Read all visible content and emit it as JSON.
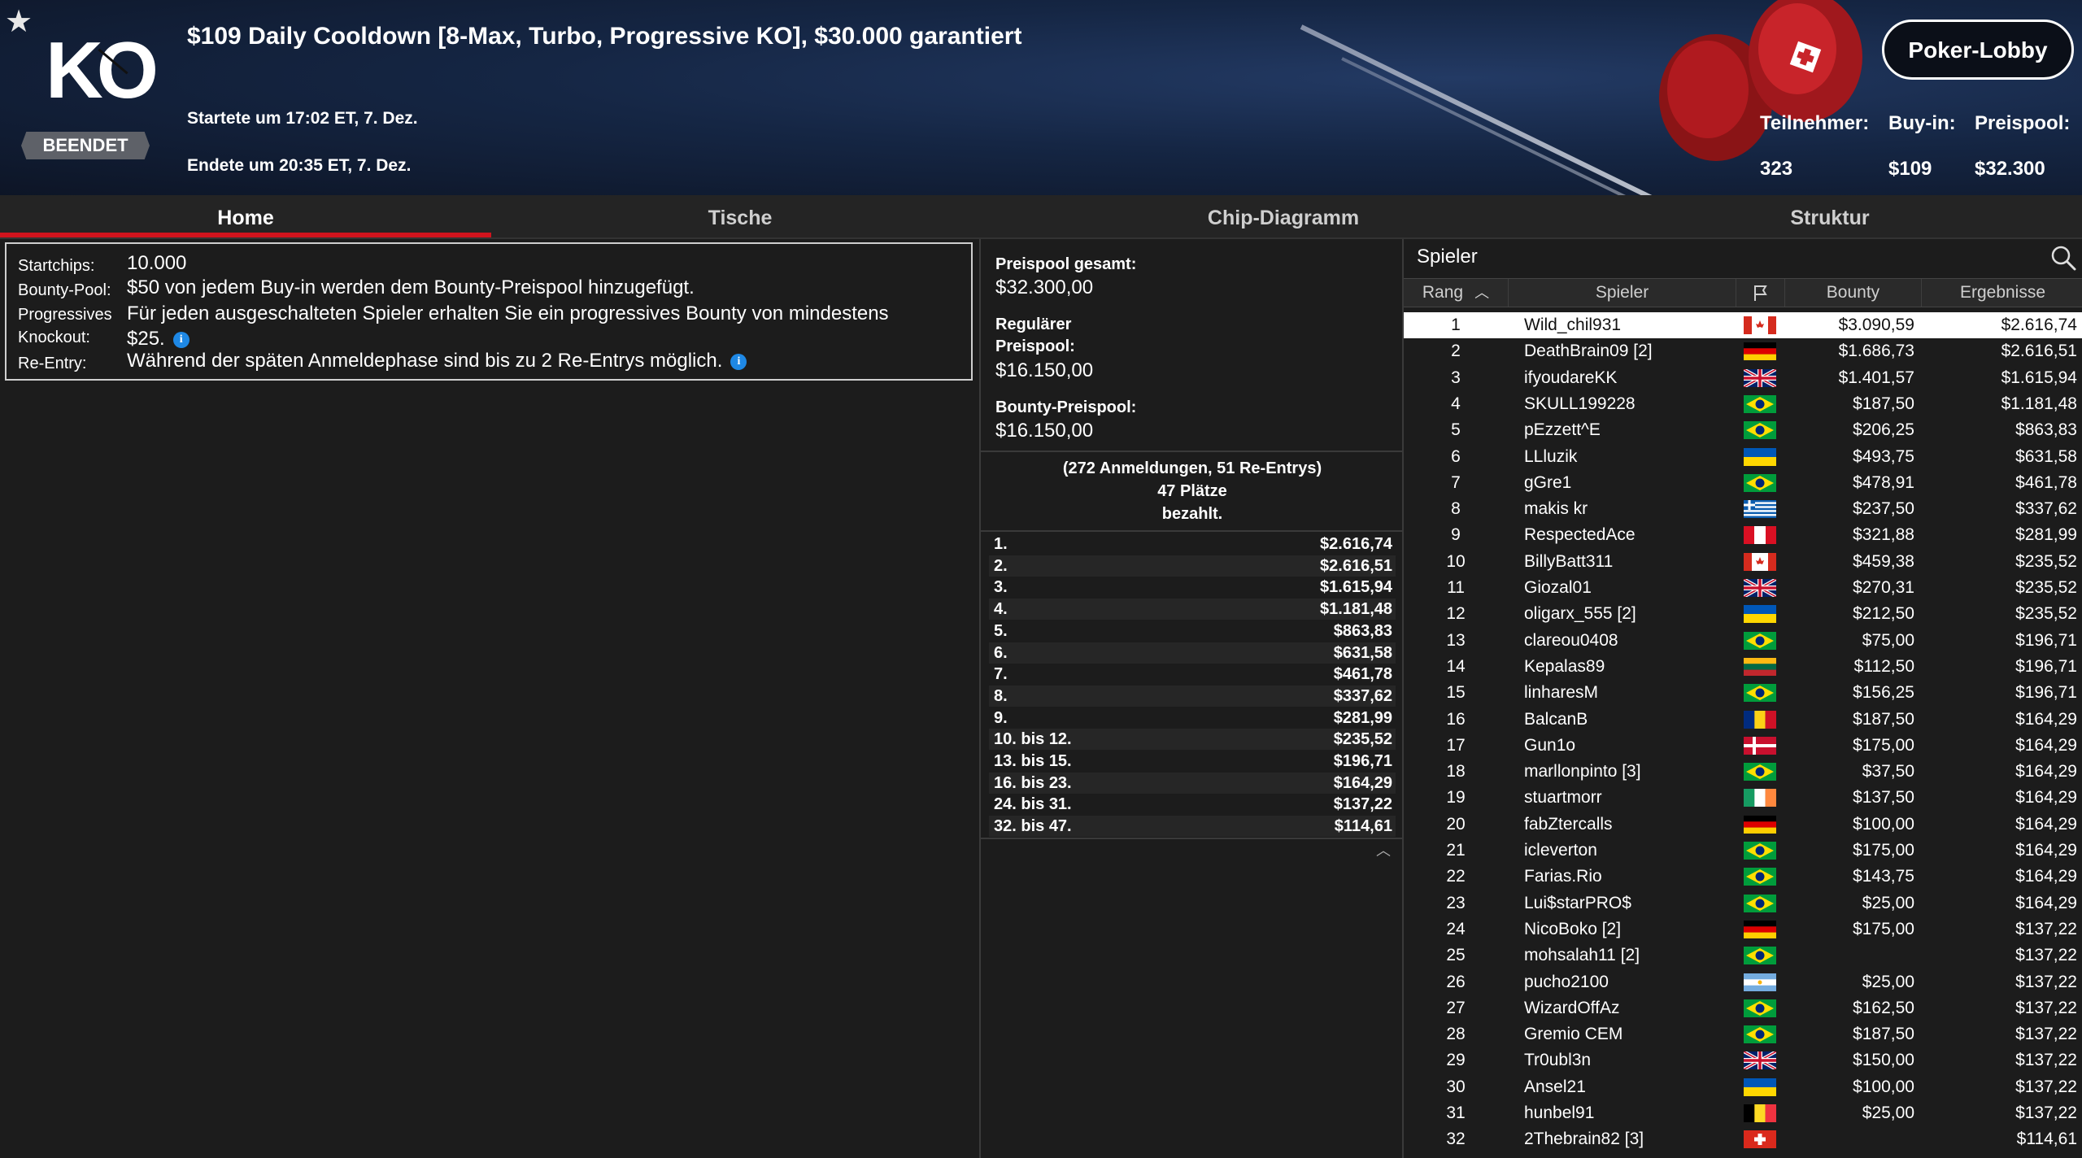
{
  "header": {
    "title": "$109 Daily Cooldown [8-Max, Turbo, Progressive KO], $30.000 garantiert",
    "logo_text": "KO",
    "status": "BEENDET",
    "started": "Startete um 17:02 ET, 7. Dez.",
    "ended": "Endete um 20:35 ET, 7. Dez.",
    "lobby_button": "Poker-Lobby",
    "stats": {
      "participants_label": "Teilnehmer:",
      "participants_value": "323",
      "buyin_label": "Buy-in:",
      "buyin_value": "$109",
      "prizepool_label": "Preispool:",
      "prizepool_value": "$32.300"
    }
  },
  "tabs": [
    "Home",
    "Tische",
    "Chip-Diagramm",
    "Struktur"
  ],
  "info": {
    "startchips_label": "Startchips:",
    "startchips_value": "10.000",
    "bounty_pool_label": "Bounty-Pool:",
    "bounty_pool_value": "$50 von jedem Buy-in werden dem Bounty-Preispool hinzugefügt.",
    "progressive_label_1": "Progressives",
    "progressive_label_2": "Knockout:",
    "progressive_value_1": "Für jeden ausgeschalteten Spieler erhalten Sie ein progressives Bounty von mindestens",
    "progressive_value_2": "$25.",
    "reentry_label": "Re-Entry:",
    "reentry_value": "Während der späten Anmeldephase sind bis zu 2 Re-Entrys möglich.",
    "info_glyph": "i"
  },
  "prizepool": {
    "total_label": "Preispool gesamt:",
    "total_value": "$32.300,00",
    "regular_label_1": "Regulärer",
    "regular_label_2": "Preispool:",
    "regular_value": "$16.150,00",
    "bounty_label": "Bounty-Preispool:",
    "bounty_value": "$16.150,00",
    "entries_line1": "(272 Anmeldungen, 51 Re-Entrys)",
    "entries_line2": "47 Plätze",
    "entries_line3": "bezahlt.",
    "payouts": [
      {
        "place": "1.",
        "amount": "$2.616,74"
      },
      {
        "place": "2.",
        "amount": "$2.616,51"
      },
      {
        "place": "3.",
        "amount": "$1.615,94"
      },
      {
        "place": "4.",
        "amount": "$1.181,48"
      },
      {
        "place": "5.",
        "amount": "$863,83"
      },
      {
        "place": "6.",
        "amount": "$631,58"
      },
      {
        "place": "7.",
        "amount": "$461,78"
      },
      {
        "place": "8.",
        "amount": "$337,62"
      },
      {
        "place": "9.",
        "amount": "$281,99"
      },
      {
        "place": "10. bis 12.",
        "amount": "$235,52"
      },
      {
        "place": "13. bis 15.",
        "amount": "$196,71"
      },
      {
        "place": "16. bis 23.",
        "amount": "$164,29"
      },
      {
        "place": "24. bis 31.",
        "amount": "$137,22"
      },
      {
        "place": "32. bis 47.",
        "amount": "$114,61"
      }
    ]
  },
  "players": {
    "title": "Spieler",
    "columns": {
      "rank": "Rang",
      "player": "Spieler",
      "bounty": "Bounty",
      "result": "Ergebnisse"
    },
    "rows": [
      {
        "rank": "1",
        "name": "Wild_chil931",
        "flag": "CA",
        "bounty": "$3.090,59",
        "result": "$2.616,74"
      },
      {
        "rank": "2",
        "name": "DeathBrain09 [2]",
        "flag": "DE",
        "bounty": "$1.686,73",
        "result": "$2.616,51"
      },
      {
        "rank": "3",
        "name": "ifyoudareKK",
        "flag": "GB",
        "bounty": "$1.401,57",
        "result": "$1.615,94"
      },
      {
        "rank": "4",
        "name": "SKULL199228",
        "flag": "BR",
        "bounty": "$187,50",
        "result": "$1.181,48"
      },
      {
        "rank": "5",
        "name": "pEzzett^E",
        "flag": "BR",
        "bounty": "$206,25",
        "result": "$863,83"
      },
      {
        "rank": "6",
        "name": "LLluzik",
        "flag": "UA",
        "bounty": "$493,75",
        "result": "$631,58"
      },
      {
        "rank": "7",
        "name": "gGre1",
        "flag": "BR",
        "bounty": "$478,91",
        "result": "$461,78"
      },
      {
        "rank": "8",
        "name": "makis kr",
        "flag": "GR",
        "bounty": "$237,50",
        "result": "$337,62"
      },
      {
        "rank": "9",
        "name": "RespectedAce",
        "flag": "PE",
        "bounty": "$321,88",
        "result": "$281,99"
      },
      {
        "rank": "10",
        "name": "BillyBatt311",
        "flag": "CA",
        "bounty": "$459,38",
        "result": "$235,52"
      },
      {
        "rank": "11",
        "name": "Giozal01",
        "flag": "GB",
        "bounty": "$270,31",
        "result": "$235,52"
      },
      {
        "rank": "12",
        "name": "oligarx_555 [2]",
        "flag": "UA",
        "bounty": "$212,50",
        "result": "$235,52"
      },
      {
        "rank": "13",
        "name": "clareou0408",
        "flag": "BR",
        "bounty": "$75,00",
        "result": "$196,71"
      },
      {
        "rank": "14",
        "name": "Kepalas89",
        "flag": "LT",
        "bounty": "$112,50",
        "result": "$196,71"
      },
      {
        "rank": "15",
        "name": "linharesM",
        "flag": "BR",
        "bounty": "$156,25",
        "result": "$196,71"
      },
      {
        "rank": "16",
        "name": "BalcanB",
        "flag": "RO",
        "bounty": "$187,50",
        "result": "$164,29"
      },
      {
        "rank": "17",
        "name": "Gun1o",
        "flag": "DK",
        "bounty": "$175,00",
        "result": "$164,29"
      },
      {
        "rank": "18",
        "name": "marllonpinto [3]",
        "flag": "BR",
        "bounty": "$37,50",
        "result": "$164,29"
      },
      {
        "rank": "19",
        "name": "stuartmorr",
        "flag": "IE",
        "bounty": "$137,50",
        "result": "$164,29"
      },
      {
        "rank": "20",
        "name": "fabZtercalls",
        "flag": "DE",
        "bounty": "$100,00",
        "result": "$164,29"
      },
      {
        "rank": "21",
        "name": "icleverton",
        "flag": "BR",
        "bounty": "$175,00",
        "result": "$164,29"
      },
      {
        "rank": "22",
        "name": "Farias.Rio",
        "flag": "BR",
        "bounty": "$143,75",
        "result": "$164,29"
      },
      {
        "rank": "23",
        "name": "Lui$starPRO$",
        "flag": "BR",
        "bounty": "$25,00",
        "result": "$164,29"
      },
      {
        "rank": "24",
        "name": "NicoBoko [2]",
        "flag": "DE",
        "bounty": "$175,00",
        "result": "$137,22"
      },
      {
        "rank": "25",
        "name": "mohsalah11 [2]",
        "flag": "BR",
        "bounty": "",
        "result": "$137,22"
      },
      {
        "rank": "26",
        "name": "pucho2100",
        "flag": "AR",
        "bounty": "$25,00",
        "result": "$137,22"
      },
      {
        "rank": "27",
        "name": "WizardOffAz",
        "flag": "BR",
        "bounty": "$162,50",
        "result": "$137,22"
      },
      {
        "rank": "28",
        "name": "Gremio CEM",
        "flag": "BR",
        "bounty": "$187,50",
        "result": "$137,22"
      },
      {
        "rank": "29",
        "name": "Tr0ubl3n",
        "flag": "GB",
        "bounty": "$150,00",
        "result": "$137,22"
      },
      {
        "rank": "30",
        "name": "Ansel21",
        "flag": "UA",
        "bounty": "$100,00",
        "result": "$137,22"
      },
      {
        "rank": "31",
        "name": "hunbel91",
        "flag": "BE",
        "bounty": "$25,00",
        "result": "$137,22"
      },
      {
        "rank": "32",
        "name": "2Thebrain82 [3]",
        "flag": "CH",
        "bounty": "",
        "result": "$114,61"
      }
    ]
  },
  "colors": {
    "accent_red": "#d0141d",
    "background": "#1c1c1c",
    "header_blue": "#152644",
    "info_blue": "#1e88e5"
  }
}
